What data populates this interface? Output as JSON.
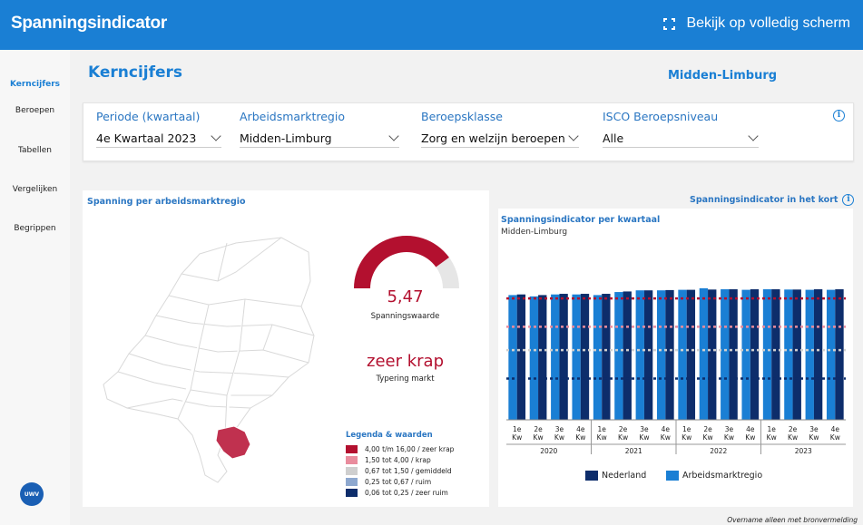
{
  "header": {
    "app_title": "Spanningsindicator",
    "fullscreen_label": "Bekijk op volledig scherm"
  },
  "sidebar": {
    "items": [
      {
        "label": "Kerncijfers",
        "active": true
      },
      {
        "label": "Beroepen"
      },
      {
        "label": "Tabellen"
      },
      {
        "label": "Vergelijken"
      },
      {
        "label": "Begrippen"
      }
    ],
    "logo_text": "UWV"
  },
  "main": {
    "page_title": "Kerncijfers",
    "region_title": "Midden-Limburg"
  },
  "filters": [
    {
      "label": "Periode (kwartaal)",
      "value": "4e Kwartaal 2023"
    },
    {
      "label": "Arbeidsmarktregio",
      "value": "Midden-Limburg"
    },
    {
      "label": "Beroepsklasse",
      "value": "Zorg en welzijn beroepen"
    },
    {
      "label": "ISCO Beroepsniveau",
      "value": "Alle"
    }
  ],
  "map_panel": {
    "title": "Spanning per arbeidsmarktregio",
    "gauge_value": "5,47",
    "gauge_fraction": 0.8,
    "gauge_caption": "Spanningswaarde",
    "typering": "zeer krap",
    "typering_caption": "Typering markt",
    "legend_title": "Legenda & waarden",
    "legend": [
      {
        "label": "4,00 t/m 16,00 / zeer krap",
        "color": "#b3102f"
      },
      {
        "label": "1,50 tot 4,00 / krap",
        "color": "#e98c9d"
      },
      {
        "label": "0,67 tot 1,50 / gemiddeld",
        "color": "#cfcfcf"
      },
      {
        "label": "0,25  tot 0,67 / ruim",
        "color": "#8ea8cf"
      },
      {
        "label": "0,06 tot 0,25 / zeer ruim",
        "color": "#0d2d6b"
      }
    ]
  },
  "kort_link": "Spanningsindicator in het kort",
  "chart_data": {
    "type": "bar",
    "title": "Spanningsindicator per kwartaal",
    "subtitle": "Midden-Limburg",
    "categories": [
      "1e Kw",
      "2e Kw",
      "3e Kw",
      "4e Kw",
      "1e Kw",
      "2e Kw",
      "3e Kw",
      "4e Kw",
      "1e Kw",
      "2e Kw",
      "3e Kw",
      "4e Kw",
      "1e Kw",
      "2e Kw",
      "3e Kw",
      "4e Kw"
    ],
    "category_lines": [
      [
        "1e",
        "Kw"
      ],
      [
        "2e",
        "Kw"
      ],
      [
        "3e",
        "Kw"
      ],
      [
        "4e",
        "Kw"
      ],
      [
        "1e",
        "Kw"
      ],
      [
        "2e",
        "Kw"
      ],
      [
        "3e",
        "Kw"
      ],
      [
        "4e",
        "Kw"
      ],
      [
        "1e",
        "Kw"
      ],
      [
        "2e",
        "Kw"
      ],
      [
        "3e",
        "Kw"
      ],
      [
        "4e",
        "Kw"
      ],
      [
        "1e",
        "Kw"
      ],
      [
        "2e",
        "Kw"
      ],
      [
        "3e",
        "Kw"
      ],
      [
        "4e",
        "Kw"
      ]
    ],
    "years": [
      "2020",
      "2021",
      "2022",
      "2023"
    ],
    "series": [
      {
        "name": "Nederland",
        "color": "#0d2d6b",
        "values": [
          4.6,
          4.5,
          4.7,
          4.7,
          4.7,
          5.1,
          5.3,
          5.35,
          5.4,
          5.45,
          5.5,
          5.5,
          5.5,
          5.45,
          5.5,
          5.5
        ]
      },
      {
        "name": "Arbeidsmarktregio",
        "color": "#1a7fd4",
        "values": [
          4.5,
          4.3,
          4.6,
          4.6,
          4.5,
          5.0,
          5.3,
          5.3,
          5.4,
          5.7,
          5.5,
          5.4,
          5.5,
          5.45,
          5.4,
          5.4
        ]
      }
    ],
    "thresholds": [
      {
        "value": 4.0,
        "color": "#b3102f"
      },
      {
        "value": 1.5,
        "color": "#e98c9d"
      },
      {
        "value": 0.67,
        "color": "#cfcfcf"
      },
      {
        "value": 0.25,
        "color": "#0d2d6b"
      }
    ],
    "y_scale": "log",
    "ylim": [
      0.06,
      16
    ],
    "legend_position": "bottom"
  },
  "footer_note": "Overname alleen met bronvermelding",
  "icons": {
    "info": "info-icon",
    "fullscreen": "fullscreen-icon",
    "dropdown": "chevron-down-icon"
  }
}
